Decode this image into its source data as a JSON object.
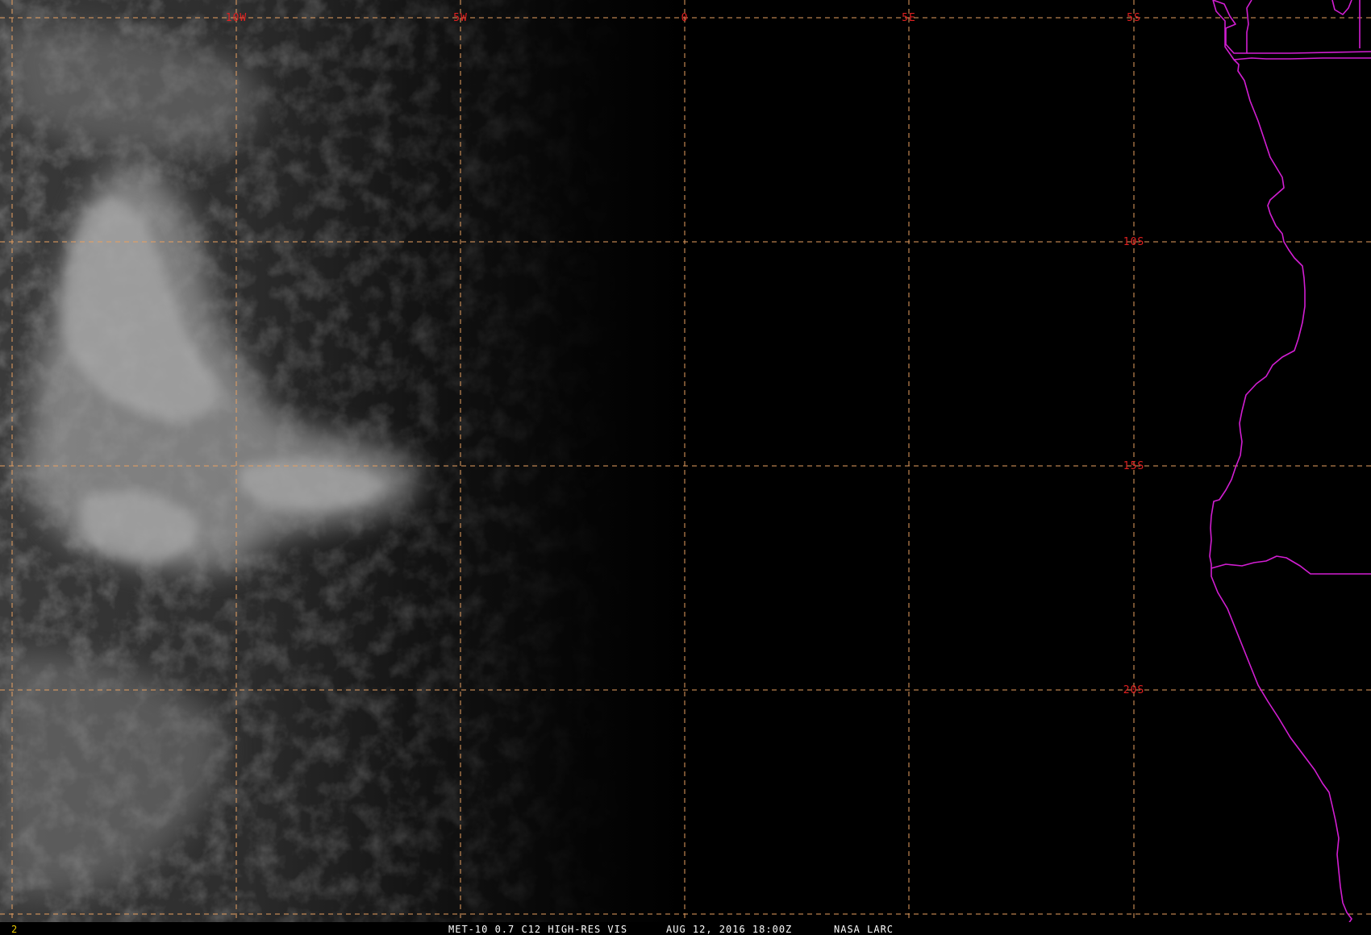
{
  "map": {
    "background_color": "#000000",
    "cloud_color": "#bdbdbd",
    "grid_color": "#e8a060",
    "coastline_color": "#d21ed2",
    "label_color": "#e02020"
  },
  "grid": {
    "lon_labels": [
      "10W",
      "5W",
      "0",
      "5E",
      "5S"
    ],
    "lat_labels": [
      "10S",
      "15S",
      "20S"
    ]
  },
  "footer": {
    "frame_number": "2",
    "product": "MET-10 0.7 C12 HIGH-RES VIS",
    "date_time": "AUG 12, 2016 18:00Z",
    "credit": "NASA LARC"
  }
}
